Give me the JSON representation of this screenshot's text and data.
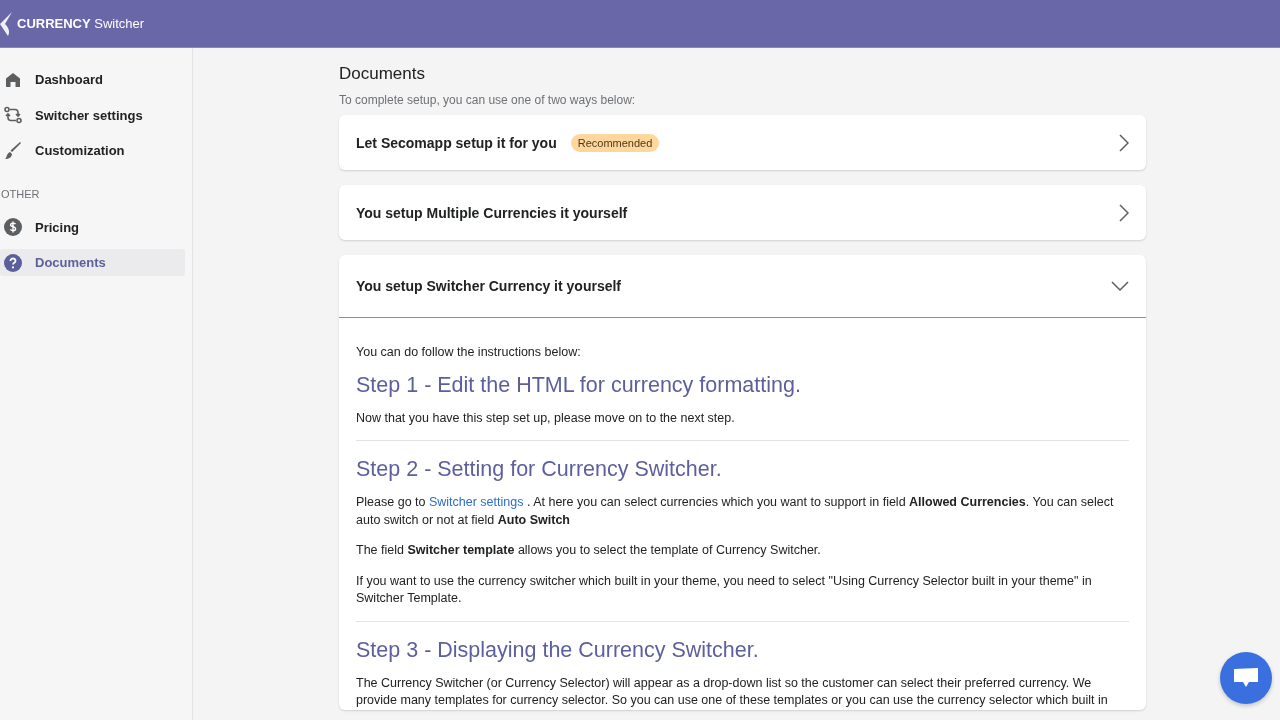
{
  "header": {
    "logo_bold": "CURRENCY",
    "logo_text": "Switcher"
  },
  "sidebar": {
    "groups": [
      {
        "items": [
          {
            "kind": "home",
            "label": "Dashboard",
            "selected": false
          },
          {
            "kind": "swap",
            "label": "Switcher settings",
            "selected": false
          },
          {
            "kind": "brush",
            "label": "Customization",
            "selected": false
          }
        ]
      },
      {
        "heading": "OTHER",
        "items": [
          {
            "kind": "dollar",
            "label": "Pricing",
            "selected": false
          },
          {
            "kind": "help",
            "label": "Documents",
            "selected": true
          }
        ]
      }
    ]
  },
  "page": {
    "title": "Documents",
    "subtitle": "To complete setup, you can use one of two ways below:",
    "sections": [
      {
        "title": "Let Secomapp setup it for you",
        "badge": "Recommended",
        "expanded": false
      },
      {
        "title": "You setup Multiple Currencies it yourself",
        "expanded": false
      },
      {
        "title": "You setup Switcher Currency it yourself",
        "expanded": true,
        "intro": "You can do follow the instructions below:",
        "steps": [
          {
            "heading": "Step 1 - Edit the HTML for currency formatting.",
            "paragraphs": [
              [
                {
                  "kind": "text",
                  "text": "Now that you have this step set up, please move on to the next step."
                }
              ]
            ]
          },
          {
            "heading": "Step 2 - Setting for Currency Switcher.",
            "paragraphs": [
              [
                {
                  "kind": "text",
                  "text": "Please go to "
                },
                {
                  "kind": "link",
                  "text": "Switcher settings"
                },
                {
                  "kind": "text",
                  "text": " . At here you can select currencies which you want to support in field **Allowed Currencies**. You can select auto switch or not at field **Auto Switch**"
                }
              ],
              [
                {
                  "kind": "text",
                  "text": "The field **Switcher template** allows you to select the template of Currency Switcher."
                }
              ],
              [
                {
                  "kind": "text",
                  "text": "If you want to use the currency switcher which built in your theme, you need to select \"Using Currency Selector built in your theme\" in Switcher Template."
                }
              ]
            ]
          },
          {
            "heading": "Step 3 - Displaying the Currency Switcher.",
            "paragraphs": [
              [
                {
                  "kind": "text",
                  "text": "The Currency Switcher (or Currency Selector) will appear as a drop-down list so the customer can select their preferred currency. We provide many templates for currency selector. So you can use one of these templates or you can use the currency selector which built in"
                }
              ]
            ]
          }
        ]
      }
    ]
  }
}
